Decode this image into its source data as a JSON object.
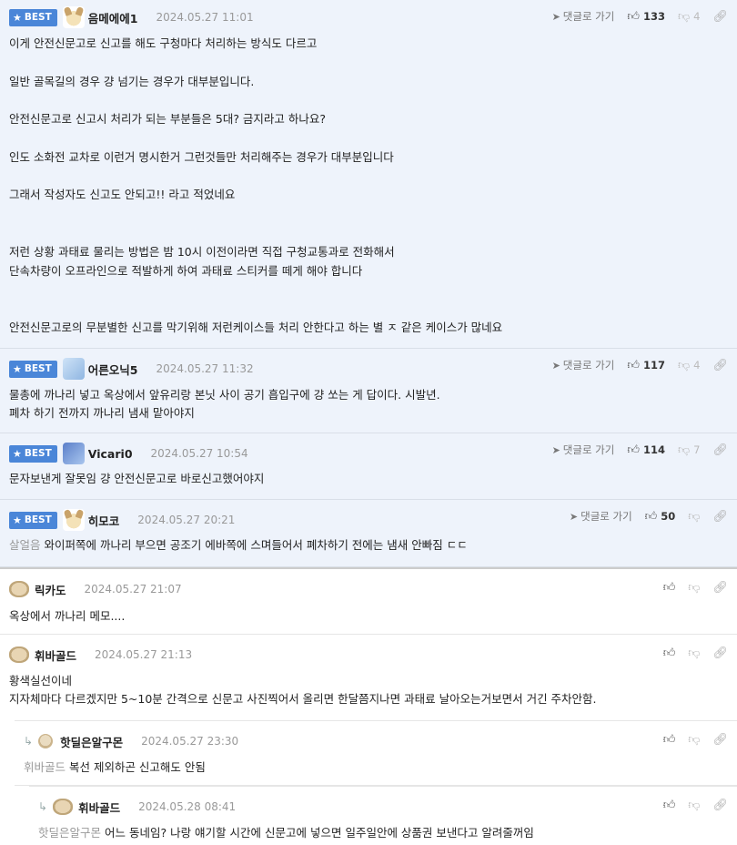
{
  "common": {
    "best_label": "BEST",
    "goto_label": "댓글로 가기"
  },
  "best_comments": [
    {
      "nick": "음메에에1",
      "date": "2024.05.27 11:01",
      "likes": "133",
      "dislikes": "4",
      "lines": [
        "이게 안전신문고로 신고를 해도 구청마다 처리하는 방식도 다르고",
        "",
        "일반 골목길의 경우 걍 넘기는 경우가 대부분입니다.",
        "",
        "안전신문고로 신고시 처리가 되는 부분들은 5대? 금지라고 하나요?",
        "",
        "인도 소화전 교차로 이런거 명시한거 그런것들만 처리해주는 경우가 대부분입니다",
        "",
        "그래서 작성자도 신고도 안되고!! 라고 적었네요",
        "",
        "",
        "저런 상황 과태료 물리는 방법은 밤 10시 이전이라면 직접 구청교통과로 전화해서",
        "단속차량이 오프라인으로 적발하게 하여 과태료 스티커를 떼게 해야 합니다",
        "",
        "",
        "안전신문고로의 무분별한 신고를 막기위해 저런케이스들 처리 안한다고 하는 별 ㅈ 같은 케이스가 많네요"
      ]
    },
    {
      "nick": "어른오닉5",
      "date": "2024.05.27 11:32",
      "likes": "117",
      "dislikes": "4",
      "lines": [
        "물총에 까나리 넣고 옥상에서 앞유리랑 본닛 사이 공기 흡입구에 걍 쏘는 게 답이다. 시발년.",
        "폐차 하기 전까지 까나리 냄새 맡아야지"
      ]
    },
    {
      "nick": "Vicari0",
      "date": "2024.05.27 10:54",
      "likes": "114",
      "dislikes": "7",
      "lines": [
        "문자보낸게 잘못임 걍 안전신문고로 바로신고했어야지"
      ]
    },
    {
      "nick": "히모코",
      "date": "2024.05.27 20:21",
      "likes": "50",
      "dislikes": "",
      "mention": "살얼음",
      "lines": [
        " 와이퍼쪽에 까나리 부으면 공조기 에바쪽에 스며들어서 폐차하기 전에는 냄새 안빠짐 ㄷㄷ"
      ]
    }
  ],
  "comments": [
    {
      "nick": "릭카도",
      "date": "2024.05.27 21:07",
      "lines": [
        "옥상에서 까나리 메모...."
      ]
    },
    {
      "nick": "휘바골드",
      "date": "2024.05.27 21:13",
      "lines": [
        "황색실선이네",
        "지자체마다 다르겠지만 5~10분 간격으로 신문고 사진찍어서 올리면 한달쯤지나면 과태료 날아오는거보면서 거긴 주차안함."
      ]
    },
    {
      "nick": "핫딜은알구몬",
      "date": "2024.05.27 23:30",
      "mention": "휘바골드",
      "lines": [
        " 복선 제외하곤 신고해도 안됨"
      ]
    },
    {
      "nick": "휘바골드",
      "date": "2024.05.28 08:41",
      "mention": "핫딜은알구몬",
      "lines": [
        " 어느 동네임? 나랑 얘기할 시간에 신문고에 넣으면 일주일안에 상품권 보낸다고 알려줄꺼임"
      ]
    }
  ]
}
